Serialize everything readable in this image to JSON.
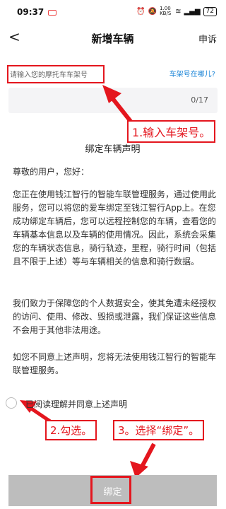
{
  "status_bar": {
    "time": "09:37",
    "speed": "1.00 KB/S",
    "battery": "72"
  },
  "header": {
    "back": "<",
    "title": "新增车辆",
    "action": "申诉"
  },
  "frame_input": {
    "placeholder": "请输入您的摩托车车架号",
    "where_link": "车架号在哪儿?",
    "counter": "0/17"
  },
  "declaration": {
    "title": "绑定车辆声明",
    "greeting": "尊敬的用户，您好：",
    "p1": "您正在使用钱江智行的智能车联管理服务，通过使用此服务，您可以将您的爱车绑定至钱江智行App上。在您成功绑定车辆后，您可以远程控制您的车辆，查看您的车辆基本信息以及车辆的使用情况。因此，系统会采集您的车辆状态信息，骑行轨迹，里程，骑行时间（包括且不限于上述）等与车辆相关的信息和骑行数据。",
    "p2": "我们致力于保障您的个人数据安全，使其免遭未经授权的访问、使用、修改、毁损或泄露，我们保证这些信息不会用于其他非法用途。",
    "p3": "如您不同意上述声明，您将无法使用钱江智行的智能车联管理服务。"
  },
  "agree_text": "已阅读理解并同意上述声明",
  "bind_button": "绑定",
  "annotations": {
    "step1": "1.输入车架号。",
    "step2": "2.勾选。",
    "step3": "3。选择“绑定”。"
  },
  "colors": {
    "annotation": "#e4161e",
    "link": "#1f87d8",
    "button_disabled": "#bdbdbd"
  }
}
